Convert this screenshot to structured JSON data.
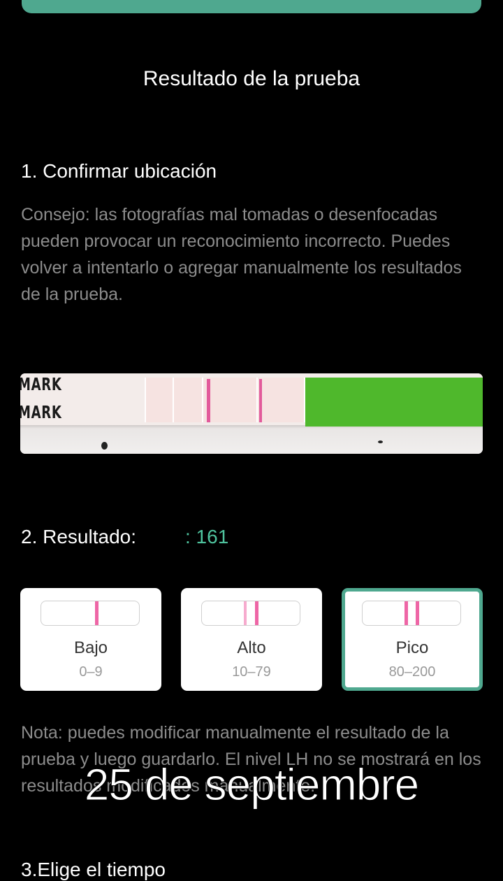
{
  "header": {
    "title": "Resultado de la prueba",
    "accent_color": "#4fa88f"
  },
  "step1": {
    "heading": "1. Confirmar ubicación",
    "tip": "Consejo: las fotografías mal tomadas o desenfocadas pueden provocar un reconocimiento incorrecto. Puedes volver a intentarlo o agregar manualmente los resultados de la prueba."
  },
  "strip_image": {
    "label_top": "MARK",
    "label_bottom": "MARK",
    "line_color": "#e25a9b",
    "pad_color": "#4fb82c"
  },
  "step2": {
    "heading": "2. Resultado:",
    "value": ": 161",
    "value_color": "#4fc39e",
    "levels": [
      {
        "name": "Bajo",
        "range": "0–9",
        "lines": 1,
        "selected": false
      },
      {
        "name": "Alto",
        "range": "10–79",
        "lines": 2,
        "selected": false
      },
      {
        "name": "Pico",
        "range": "80–200",
        "lines": 2,
        "selected": true
      }
    ]
  },
  "note": "Nota: puedes modificar manualmente el resultado de la prueba y luego guardarlo. El nivel LH no se mostrará en los resultados modificados manualmente.",
  "overlay_date": "25 de septiembre",
  "step3": {
    "heading": "3.Elige el tiempo"
  }
}
